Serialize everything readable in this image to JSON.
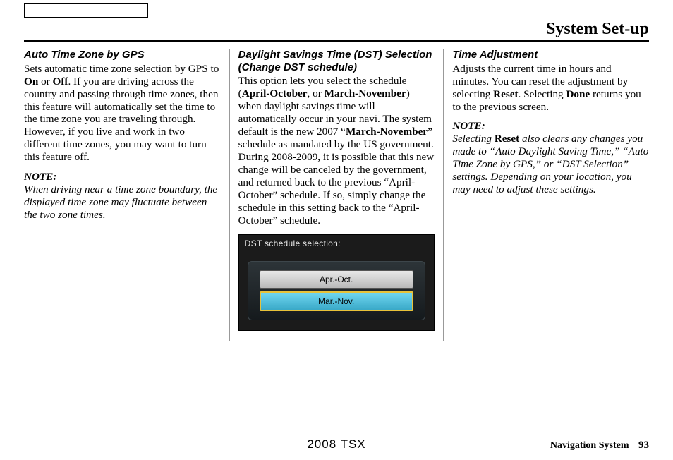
{
  "header": {
    "title": "System Set-up"
  },
  "col1": {
    "heading": "Auto Time Zone by GPS",
    "p1a": "Sets automatic time zone selection by GPS to ",
    "on": "On",
    "p1b": " or ",
    "off": "Off",
    "p1c": ". If you are driving across the country and passing through time zones, then this feature will automatically set the time to the time zone you are traveling through. However, if you live and work in two different time zones, you may want to turn this feature off.",
    "note_head": "NOTE:",
    "note_body": "When driving near a time zone boundary, the displayed time zone may fluctuate between the two zone times."
  },
  "col2": {
    "heading": "Daylight Savings Time (DST) Selection (Change DST schedule)",
    "p1a": "This option lets you select the schedule (",
    "b1": "April-October",
    "p1b": ", or ",
    "b2": "March-November",
    "p1c": ") when daylight savings time will automatically occur in your navi. The system default is the new 2007 “",
    "b3": "March-November",
    "p1d": "” schedule as mandated by the US government. During 2008-2009, it is possible that this new change will be canceled by the government, and returned back to the previous “April-October” schedule. If so, simply change the schedule in this setting back to the “April-October” schedule.",
    "screenshot": {
      "title": "DST schedule selection:",
      "opt1": "Apr.-Oct.",
      "opt2": "Mar.-Nov."
    }
  },
  "col3": {
    "heading": "Time Adjustment",
    "p1a": "Adjusts the current time in hours and minutes. You can reset the adjustment by selecting ",
    "b1": "Reset",
    "p1b": ". Selecting ",
    "b2": "Done",
    "p1c": " returns you to the previous screen.",
    "note_head": "NOTE:",
    "note_a": "Selecting ",
    "note_b": "Reset",
    "note_c": " also clears any changes you made to “Auto Daylight Saving Time,” “Auto Time Zone by GPS,” or “DST Selection” settings. Depending on your location, you may need to adjust these settings."
  },
  "footer": {
    "model": "2008  TSX",
    "label": "Navigation System",
    "page": "93"
  }
}
